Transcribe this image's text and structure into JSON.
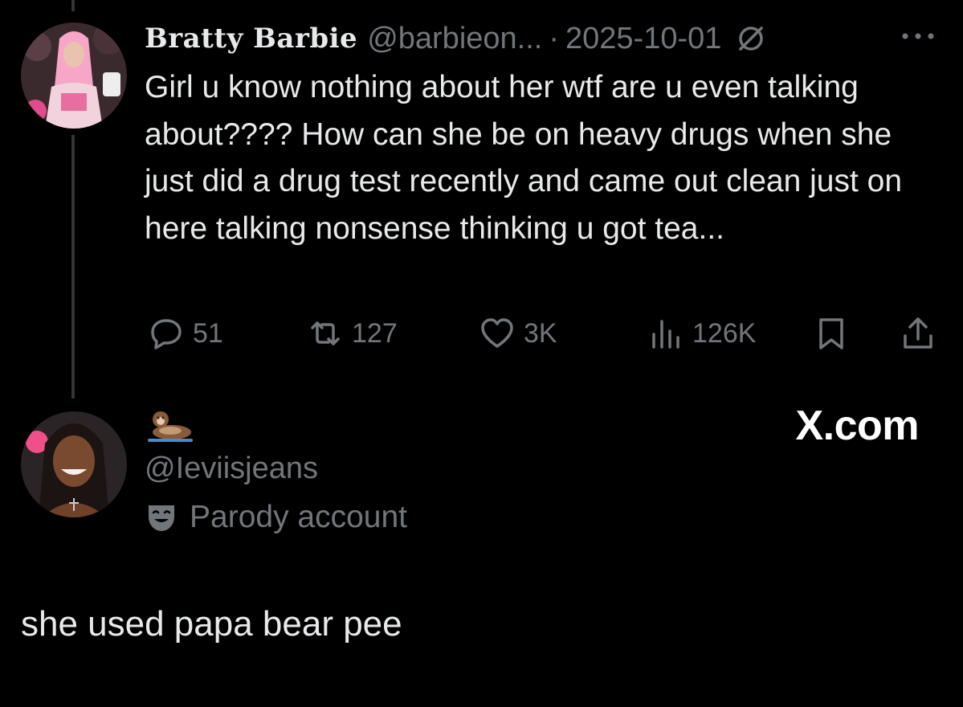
{
  "tweet": {
    "display_name": "Bratty Barbie",
    "handle": "@barbieon...",
    "separator": "·",
    "date": "2025-10-01",
    "badge_icon": "parody-mask-icon",
    "more_icon": "more-dots-icon",
    "text": "Girl u know nothing about her wtf are u even talking about???? How can she be on heavy drugs when she just did a drug test recently and came out clean just on here talking nonsense thinking u got tea...",
    "actions": {
      "replies": "51",
      "reposts": "127",
      "likes": "3K",
      "views": "126K"
    }
  },
  "reply_author": {
    "name_emoji_icon": "otter-emoji-icon",
    "handle": "@Ieviisjeans",
    "label": "Parody account",
    "label_icon": "parody-mask-icon"
  },
  "watermark": "X.com",
  "reply_text": "she used papa bear pee",
  "colors": {
    "background": "#000000",
    "primary_text": "#e7e9ea",
    "secondary_text": "#71767b",
    "thread_line": "#333639"
  }
}
